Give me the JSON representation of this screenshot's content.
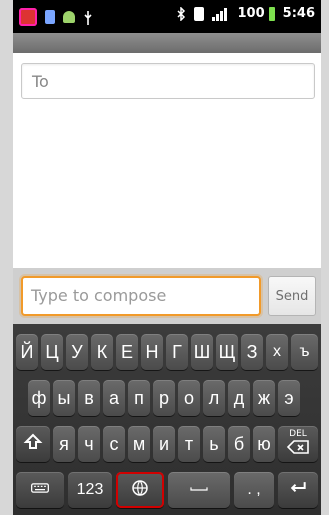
{
  "status_bar": {
    "battery": "100",
    "time": "5:46",
    "icons": [
      "app-notification-icon",
      "sd-card-icon",
      "android-debug-icon",
      "usb-icon",
      "bluetooth-icon",
      "sim-icon",
      "signal-icon"
    ]
  },
  "recipient": {
    "placeholder": "To"
  },
  "compose": {
    "placeholder": "Type to compose",
    "send_label": "Send"
  },
  "keyboard": {
    "row1": [
      "Й",
      "Ц",
      "У",
      "К",
      "Е",
      "Н",
      "Г",
      "Ш",
      "Щ",
      "З",
      "х",
      "ъ"
    ],
    "row2": [
      "ф",
      "ы",
      "в",
      "а",
      "п",
      "р",
      "о",
      "л",
      "д",
      "ж",
      "э"
    ],
    "row3": [
      "я",
      "ч",
      "с",
      "м",
      "и",
      "т",
      "ь",
      "б",
      "ю"
    ],
    "delete_label": "DEL",
    "numbers_label": "123",
    "punct_label": ". ,"
  },
  "colors": {
    "accent": "#f19a2a",
    "selected_outline": "#d10000",
    "battery_green": "#7ee04f"
  }
}
